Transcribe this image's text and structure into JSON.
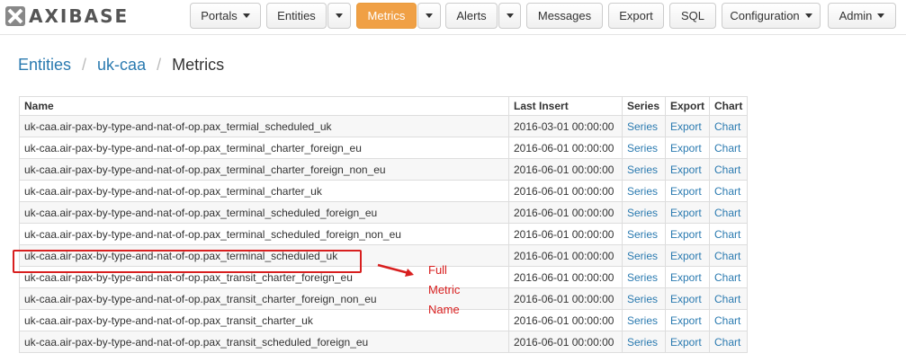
{
  "navbar": {
    "brand": "AXIBASE",
    "items": [
      {
        "label": "Portals"
      },
      {
        "label": "Entities"
      },
      {
        "label": "Metrics"
      },
      {
        "label": "Alerts"
      },
      {
        "label": "Messages"
      },
      {
        "label": "Export"
      },
      {
        "label": "SQL"
      },
      {
        "label": "Configuration"
      },
      {
        "label": "Admin"
      }
    ]
  },
  "breadcrumb": {
    "entities": "Entities",
    "entity": "uk-caa",
    "current": "Metrics"
  },
  "table": {
    "headers": {
      "name": "Name",
      "last_insert": "Last Insert",
      "series": "Series",
      "export": "Export",
      "chart": "Chart"
    },
    "rows": [
      {
        "name": "uk-caa.air-pax-by-type-and-nat-of-op.pax_termial_scheduled_uk",
        "last_insert": "2016-03-01 00:00:00",
        "series": "Series",
        "export": "Export",
        "chart": "Chart"
      },
      {
        "name": "uk-caa.air-pax-by-type-and-nat-of-op.pax_terminal_charter_foreign_eu",
        "last_insert": "2016-06-01 00:00:00",
        "series": "Series",
        "export": "Export",
        "chart": "Chart"
      },
      {
        "name": "uk-caa.air-pax-by-type-and-nat-of-op.pax_terminal_charter_foreign_non_eu",
        "last_insert": "2016-06-01 00:00:00",
        "series": "Series",
        "export": "Export",
        "chart": "Chart"
      },
      {
        "name": "uk-caa.air-pax-by-type-and-nat-of-op.pax_terminal_charter_uk",
        "last_insert": "2016-06-01 00:00:00",
        "series": "Series",
        "export": "Export",
        "chart": "Chart"
      },
      {
        "name": "uk-caa.air-pax-by-type-and-nat-of-op.pax_terminal_scheduled_foreign_eu",
        "last_insert": "2016-06-01 00:00:00",
        "series": "Series",
        "export": "Export",
        "chart": "Chart"
      },
      {
        "name": "uk-caa.air-pax-by-type-and-nat-of-op.pax_terminal_scheduled_foreign_non_eu",
        "last_insert": "2016-06-01 00:00:00",
        "series": "Series",
        "export": "Export",
        "chart": "Chart"
      },
      {
        "name": "uk-caa.air-pax-by-type-and-nat-of-op.pax_terminal_scheduled_uk",
        "last_insert": "2016-06-01 00:00:00",
        "series": "Series",
        "export": "Export",
        "chart": "Chart"
      },
      {
        "name": "uk-caa.air-pax-by-type-and-nat-of-op.pax_transit_charter_foreign_eu",
        "last_insert": "2016-06-01 00:00:00",
        "series": "Series",
        "export": "Export",
        "chart": "Chart"
      },
      {
        "name": "uk-caa.air-pax-by-type-and-nat-of-op.pax_transit_charter_foreign_non_eu",
        "last_insert": "2016-06-01 00:00:00",
        "series": "Series",
        "export": "Export",
        "chart": "Chart"
      },
      {
        "name": "uk-caa.air-pax-by-type-and-nat-of-op.pax_transit_charter_uk",
        "last_insert": "2016-06-01 00:00:00",
        "series": "Series",
        "export": "Export",
        "chart": "Chart"
      },
      {
        "name": "uk-caa.air-pax-by-type-and-nat-of-op.pax_transit_scheduled_foreign_eu",
        "last_insert": "2016-06-01 00:00:00",
        "series": "Series",
        "export": "Export",
        "chart": "Chart"
      }
    ]
  },
  "annotation": {
    "lines": [
      "Full",
      "Metric",
      "Name"
    ],
    "color": "#d81f1f"
  },
  "colors": {
    "accent": "#f0a045",
    "link": "#2a7ab0"
  }
}
